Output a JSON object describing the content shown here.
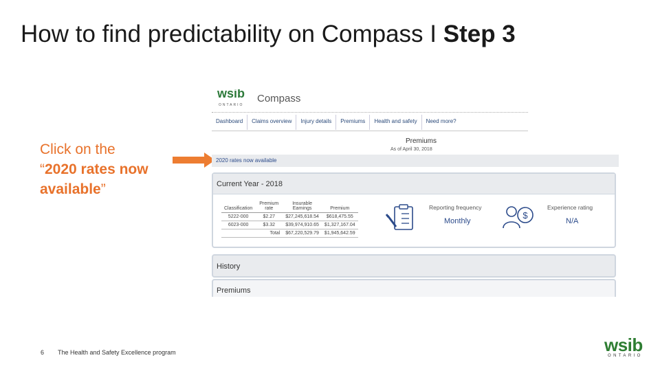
{
  "slide": {
    "title_prefix": "How to find predictability on Compass I ",
    "title_bold": "Step 3",
    "instruction_line1": "Click on the",
    "instruction_quote_open": "“",
    "instruction_bold": "2020 rates now available",
    "instruction_quote_close": "”",
    "page_number": "6",
    "footer_text": "The Health and Safety Excellence program",
    "brand_name": "wsib",
    "brand_sub": "ONTARIO",
    "arrow_color": "#ED7D31"
  },
  "compass": {
    "logo_name": "wsib",
    "logo_sub": "ONTARIO",
    "app_name": "Compass",
    "nav": [
      "Dashboard",
      "Claims overview",
      "Injury details",
      "Premiums",
      "Health and safety",
      "Need more?"
    ],
    "premiums_title": "Premiums",
    "as_of": "As of April 30, 2018",
    "rates_link": "2020 rates now available",
    "current_year": {
      "title": "Current Year - 2018",
      "headers": [
        "Classification",
        "Premium rate",
        "Insurable Earnings",
        "Premium"
      ],
      "rows": [
        [
          "5222-000",
          "$2.27",
          "$27,245,618.54",
          "$618,475.55"
        ],
        [
          "6023-000",
          "$3.32",
          "$39,974,910.65",
          "$1,327,167.04"
        ]
      ],
      "total_label": "Total",
      "total_earnings": "$67,220,529.79",
      "total_premium": "$1,945,642.59",
      "reporting_label": "Reporting frequency",
      "reporting_value": "Monthly",
      "experience_label": "Experience rating",
      "experience_value": "N/A"
    },
    "history_label": "History",
    "premiums_section_label": "Premiums"
  }
}
